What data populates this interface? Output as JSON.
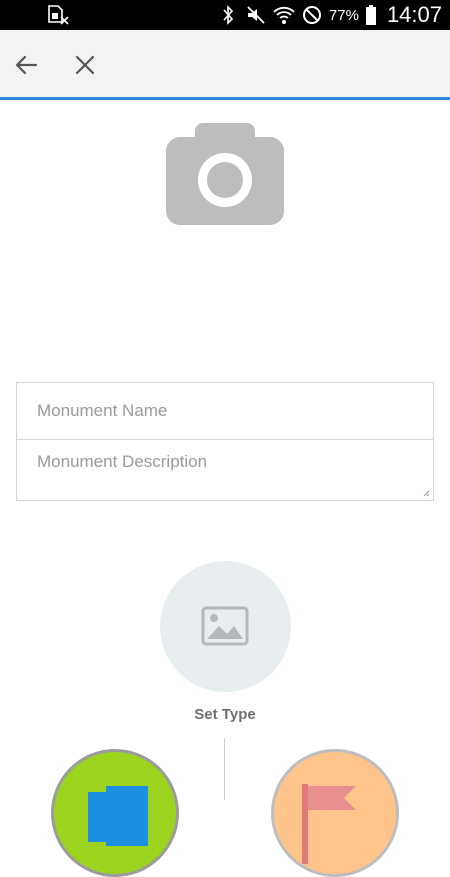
{
  "status_bar": {
    "battery_percent": "77%",
    "time": "14:07",
    "icons": [
      "sim-card-off-icon",
      "bluetooth-icon",
      "mute-icon",
      "wifi-icon",
      "do-not-disturb-icon",
      "battery-icon"
    ]
  },
  "app_bar": {
    "back_icon": "arrow-left-icon",
    "close_icon": "close-icon",
    "accent_color": "#2f86d6"
  },
  "form": {
    "name_placeholder": "Monument Name",
    "name_value": "",
    "description_placeholder": "Monument Description",
    "description_value": ""
  },
  "type_selector": {
    "label": "Set Type",
    "icon": "image-icon",
    "options": [
      {
        "icon": "monument-type-icon",
        "color": "#9bd31f"
      },
      {
        "icon": "flag-type-icon",
        "color": "#ffc48a"
      }
    ]
  }
}
